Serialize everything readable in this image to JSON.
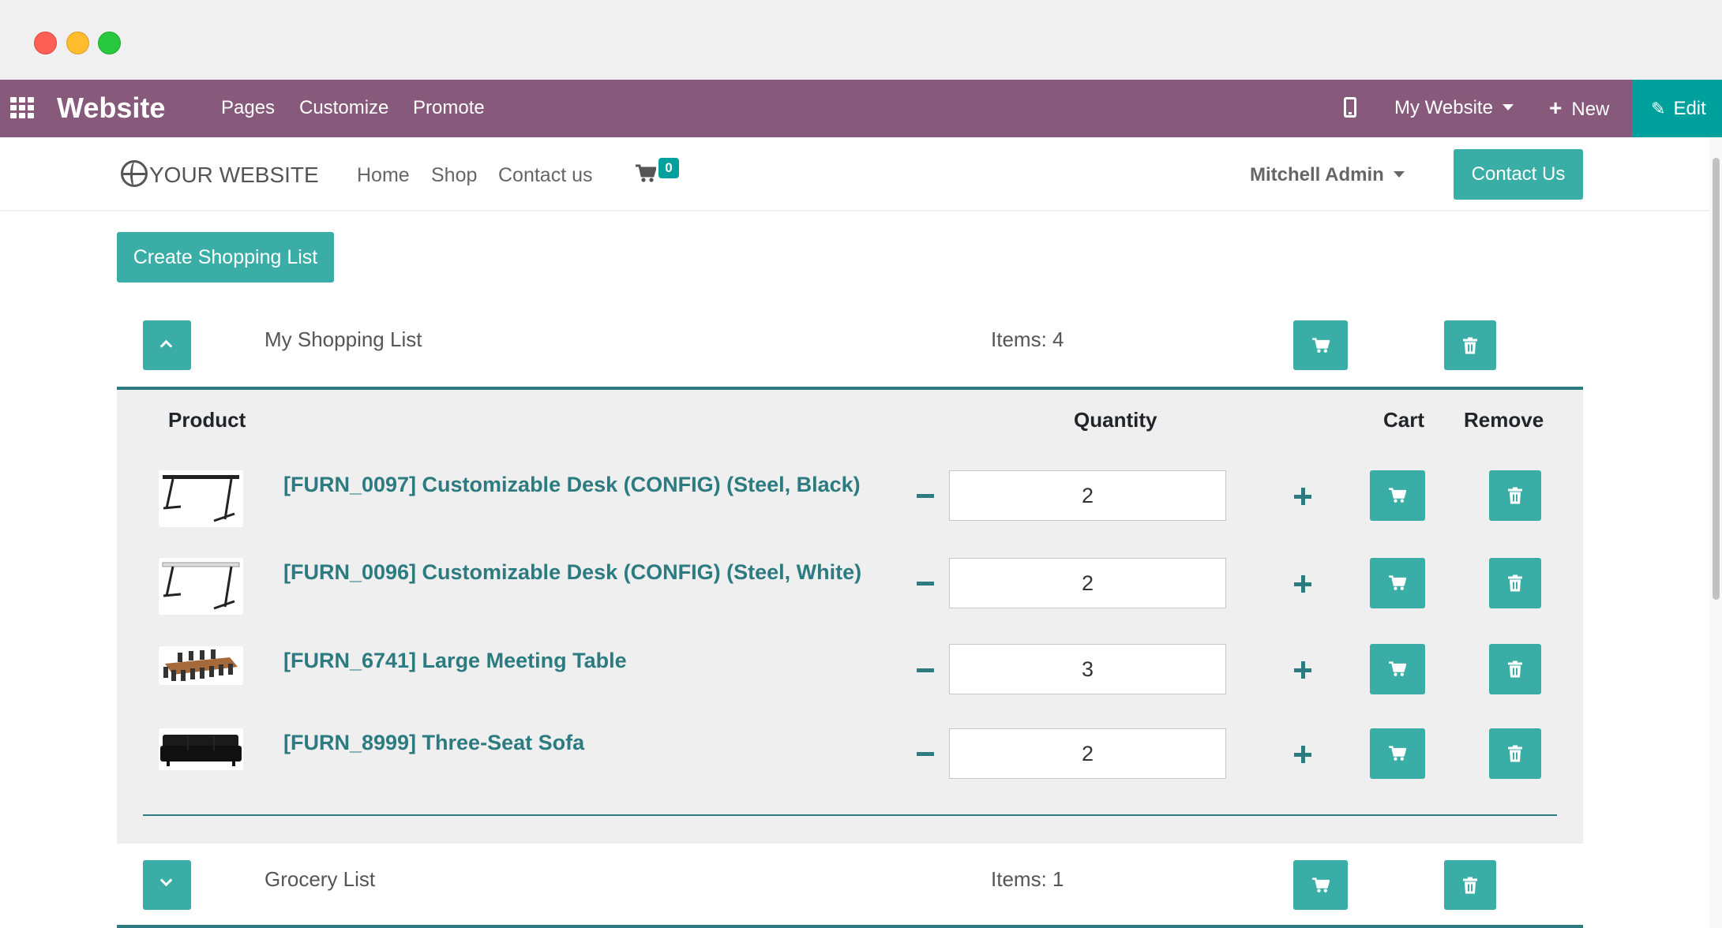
{
  "window": {
    "controls": [
      "close",
      "minimize",
      "maximize"
    ]
  },
  "admin_bar": {
    "app_name": "Website",
    "menu": [
      "Pages",
      "Customize",
      "Promote"
    ],
    "website_selector": "My Website",
    "new_label": "New",
    "edit_label": "Edit",
    "icons": {
      "apps": "apps-grid-icon",
      "device": "mobile-preview-icon",
      "edit": "pencil-icon"
    },
    "color": "#875a7b"
  },
  "site_nav": {
    "logo_text": "YOUR WEBSITE",
    "links": [
      "Home",
      "Shop",
      "Contact us"
    ],
    "cart_count": "0",
    "user_name": "Mitchell Admin",
    "contact_button": "Contact Us"
  },
  "page": {
    "create_button": "Create Shopping List",
    "columns": {
      "product": "Product",
      "quantity": "Quantity",
      "cart": "Cart",
      "remove": "Remove"
    },
    "lists": [
      {
        "name": "My Shopping List",
        "items_label": "Items: 4",
        "expanded": true,
        "products": [
          {
            "name": "[FURN_0097] Customizable Desk (CONFIG) (Steel, Black)",
            "quantity": "2",
            "thumb": "black-desk"
          },
          {
            "name": "[FURN_0096] Customizable Desk (CONFIG) (Steel, White)",
            "quantity": "2",
            "thumb": "white-desk"
          },
          {
            "name": "[FURN_6741] Large Meeting Table",
            "quantity": "3",
            "thumb": "meeting-table"
          },
          {
            "name": "[FURN_8999] Three-Seat Sofa",
            "quantity": "2",
            "thumb": "sofa"
          }
        ]
      },
      {
        "name": "Grocery List",
        "items_label": "Items: 1",
        "expanded": false
      }
    ]
  },
  "colors": {
    "accent": "#3aada7",
    "link": "#2c7b81",
    "edit_bg": "#00a09d"
  }
}
